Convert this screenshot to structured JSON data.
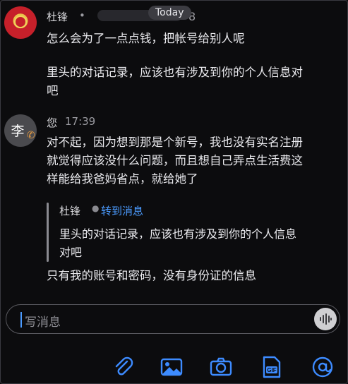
{
  "date_separator": "Today",
  "message1": {
    "sender": "杜锋",
    "time_partial": "8",
    "lines": [
      "怎么会为了一点点钱，把帐号给别人呢",
      "里头的对话记录，应该也有涉及到你的个人信息对",
      "吧"
    ]
  },
  "message2": {
    "avatar_text": "李",
    "sender": "您",
    "time": "17:39",
    "lines": [
      "对不起，因为想到那是个新号，我也没有实名注册",
      "就觉得应该没什么问题，而且想自己弄点生活费这",
      "样能给我爸妈省点，就给她了"
    ],
    "quote": {
      "name": "杜锋",
      "link": "转到消息",
      "lines": [
        "里头的对话记录，应该也有涉及到你的个人信息",
        "对吧"
      ]
    },
    "reply": "只有我的账号和密码，没有身份证的信息"
  },
  "composer": {
    "placeholder": "写消息"
  },
  "colors": {
    "background": "#0c0c0e",
    "accent": "#4b9bff"
  },
  "toolbar": {
    "icons": [
      "paperclip-icon",
      "image-icon",
      "camera-icon",
      "gif-icon",
      "at-icon"
    ]
  }
}
